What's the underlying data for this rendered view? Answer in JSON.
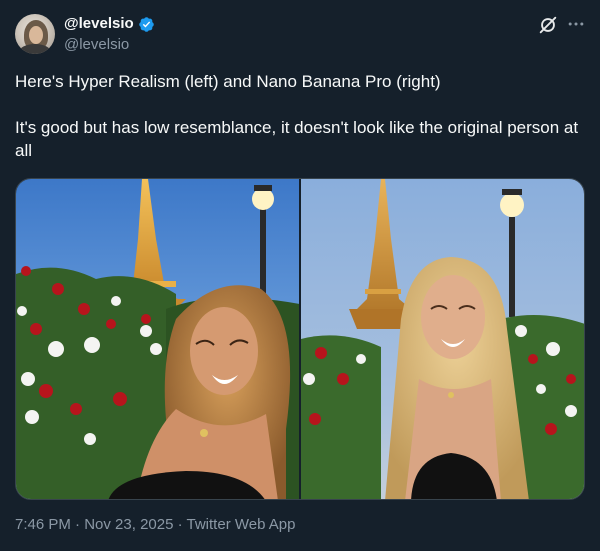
{
  "author": {
    "display_name": "@levelsio",
    "handle": "@levelsio",
    "verified_badge_color": "#1d9bf0"
  },
  "tweet": {
    "line1": "Here's Hyper Realism (left) and Nano Banana Pro (right)",
    "line2": "It's good but has low resemblance, it doesn't look like the original person at all"
  },
  "media": [
    {
      "label": "left-photo"
    },
    {
      "label": "right-photo"
    }
  ],
  "meta": {
    "time": "7:46 PM",
    "separator": " · ",
    "date": "Nov 23, 2025",
    "source": "Twitter Web App"
  },
  "icons": {
    "grok": "grok-icon",
    "more": "more-icon",
    "verified": "verified-badge-icon"
  },
  "colors": {
    "background": "#15202b",
    "text": "#f7f9f9",
    "secondary": "#8b98a5",
    "accent": "#1d9bf0"
  }
}
